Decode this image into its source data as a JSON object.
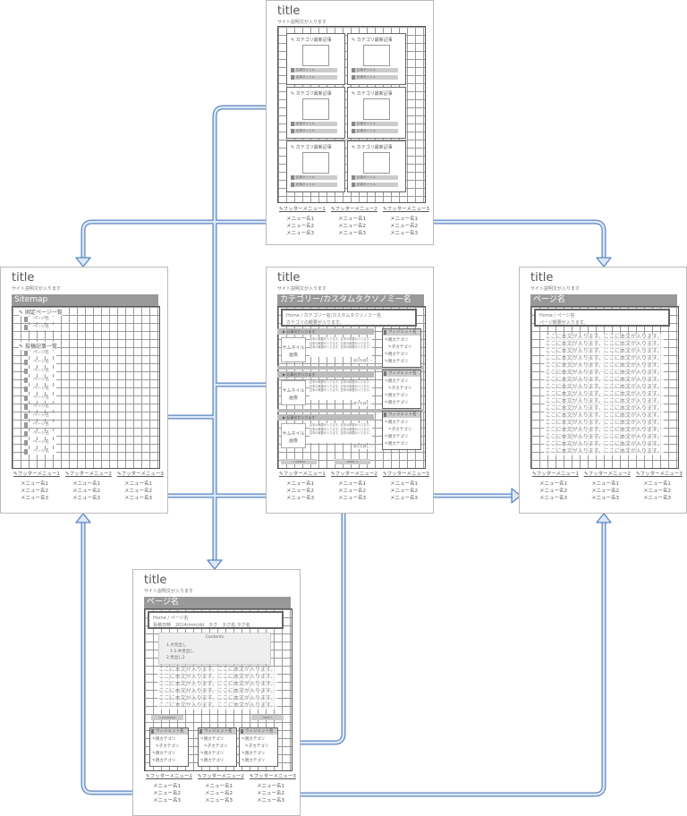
{
  "common": {
    "title": "title",
    "desc": "サイト説明文が入ります",
    "footer": {
      "menus": [
        "フッターメニュー1",
        "フッターメニュー2",
        "フッターメニュー3"
      ],
      "items": [
        "メニュー名1",
        "メニュー名2",
        "メニュー名3"
      ]
    }
  },
  "top": {
    "cat_title": "カテゴリ最新記事",
    "article": "記事タイトル"
  },
  "sitemap": {
    "header": "Sitemap",
    "fixed": "固定ページ一覧",
    "posts": "投稿記事一覧",
    "page": "ページ名"
  },
  "category": {
    "header": "カテゴリー/カスタムタクソノミー名",
    "bread1": "Home / カテゴリー名/カスタムタクソノミー名",
    "bread2": "カテゴリの概要が入ります。",
    "post_title": "記事名が入ります",
    "thumb1": "サムネイル",
    "thumb2": "画像",
    "excerpt": "記事の概要が入ります。記事の概要が入ります。記事の概要が入ります。記事の概要が入ります。記事の概要が入ります。記事の概要が入ります。",
    "more": "続きを読む »",
    "prev": "« newer",
    "next": "older »"
  },
  "widget": {
    "title": "ウィジェット名",
    "parent": "親カテゴリ",
    "child": "子カテゴリ"
  },
  "page": {
    "header": "ページ名",
    "bread1": "Home / ページ名",
    "bread2": "ページ概要が入ります。",
    "body": "ここに本文が入ります。ここに本文が入ります。"
  },
  "single": {
    "header": "ページ名",
    "bread1": "Home / ページ名",
    "bread2": "投稿日時　2014/mm/dd　タグ　タグ名,タグ名",
    "toc_title": "Contents",
    "toc": [
      "1.大見出し",
      "1-1.中見出し",
      "2.見出し2"
    ],
    "body": "ここに本文が入ります。ここに本文が入ります。",
    "prev": "« previous",
    "next": "next »"
  }
}
